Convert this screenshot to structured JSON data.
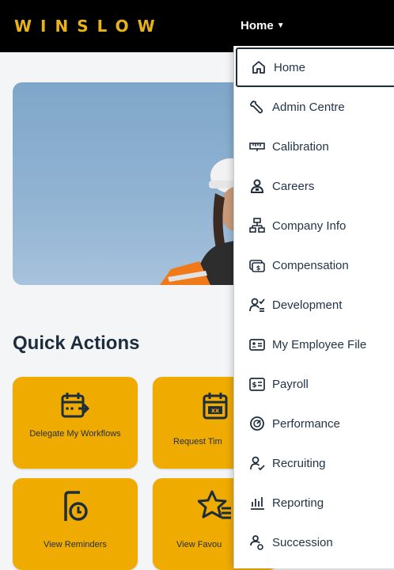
{
  "topbar": {
    "logo": "WINSLOW",
    "nav_label": "Home",
    "nav_caret": "▼"
  },
  "hero": {
    "alt": ""
  },
  "quick_actions": {
    "title": "Quick Actions",
    "tiles": [
      {
        "label": "Delegate My Workflows",
        "icon": "calendar-forward-icon"
      },
      {
        "label": "Request Tim",
        "icon": "calendar-cancel-icon"
      },
      {
        "label": "View Reminders",
        "icon": "document-clock-icon"
      },
      {
        "label": "View Favou",
        "icon": "star-list-icon"
      }
    ]
  },
  "menu": {
    "items": [
      {
        "label": "Home",
        "icon": "home-icon",
        "active": true
      },
      {
        "label": "Admin Centre",
        "icon": "wrench-icon"
      },
      {
        "label": "Calibration",
        "icon": "ruler-icon"
      },
      {
        "label": "Careers",
        "icon": "person-icon"
      },
      {
        "label": "Company Info",
        "icon": "org-chart-icon"
      },
      {
        "label": "Compensation",
        "icon": "money-icon"
      },
      {
        "label": "Development",
        "icon": "person-development-icon"
      },
      {
        "label": "My Employee File",
        "icon": "id-card-icon"
      },
      {
        "label": "Payroll",
        "icon": "payroll-icon"
      },
      {
        "label": "Performance",
        "icon": "gauge-icon"
      },
      {
        "label": "Recruiting",
        "icon": "person-check-icon"
      },
      {
        "label": "Reporting",
        "icon": "bar-chart-icon"
      },
      {
        "label": "Succession",
        "icon": "succession-icon"
      }
    ]
  }
}
